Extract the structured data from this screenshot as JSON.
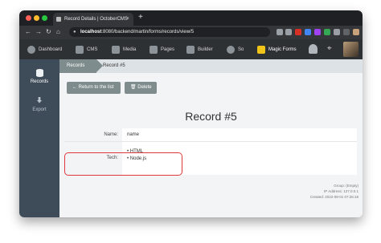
{
  "browser": {
    "tab_title": "Record Details | OctoberCMS",
    "tab_close": "×",
    "new_tab": "+",
    "url_host": "localhost",
    "url_path": ":8080/backend/martin/forms/records/view/5"
  },
  "topnav": {
    "items": [
      {
        "label": "Dashboard"
      },
      {
        "label": "CMS"
      },
      {
        "label": "Media"
      },
      {
        "label": "Pages"
      },
      {
        "label": "Builder"
      },
      {
        "label": "So"
      },
      {
        "label": "Magic Forms"
      }
    ]
  },
  "sidebar": {
    "items": [
      {
        "label": "Records"
      },
      {
        "label": "Export"
      }
    ]
  },
  "breadcrumb": {
    "parent": "Records",
    "current": "Record #5"
  },
  "toolbar": {
    "back_label": "Return to the list",
    "delete_label": "Delete"
  },
  "record": {
    "title": "Record #5",
    "fields": [
      {
        "label": "Name:",
        "value": "name"
      },
      {
        "label": "Tech:",
        "values": [
          "HTML",
          "Node.js"
        ]
      }
    ],
    "meta": {
      "group": "Group: (Empty)",
      "ip": "IP Address: 127.0.0.1",
      "created": "Created: 2022-08-01 07:26:18"
    }
  },
  "colors": {
    "topnav_bg": "#2d3134",
    "sidebar_bg": "#3e4c59",
    "button_bg": "#7f8c8d",
    "highlight": "#e2383c",
    "magic_forms_accent": "#f0c419"
  }
}
